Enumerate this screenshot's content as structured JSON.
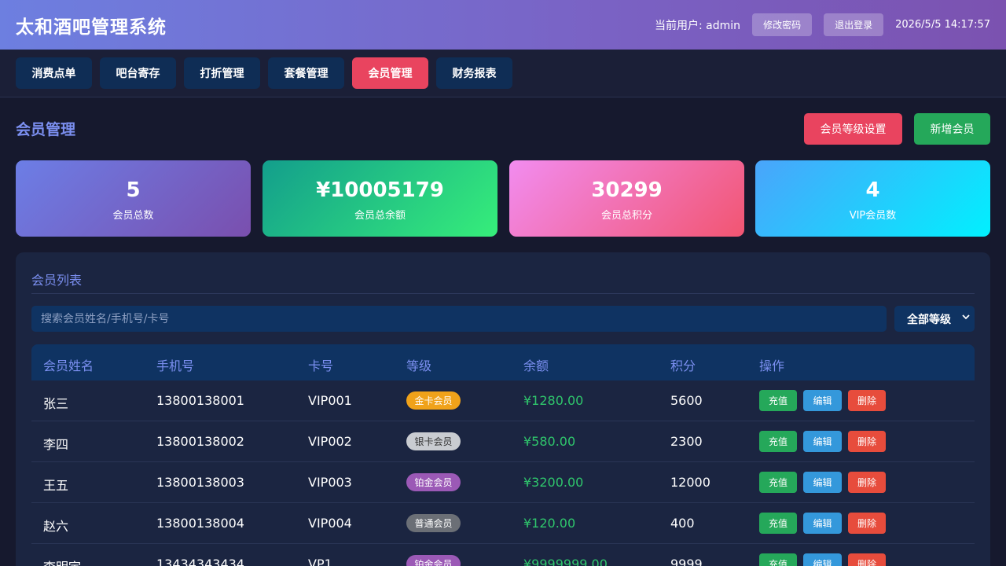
{
  "header": {
    "title": "太和酒吧管理系统",
    "current_user": "当前用户: admin",
    "change_password": "修改密码",
    "logout": "退出登录",
    "datetime": "2026/5/5 14:17:57"
  },
  "nav": {
    "tabs": [
      {
        "label": "消费点单"
      },
      {
        "label": "吧台寄存"
      },
      {
        "label": "打折管理"
      },
      {
        "label": "套餐管理"
      },
      {
        "label": "会员管理",
        "active": true
      },
      {
        "label": "财务报表"
      }
    ]
  },
  "page": {
    "title": "会员管理",
    "level_settings_button": "会员等级设置",
    "add_member_button": "新增会员"
  },
  "stats": [
    {
      "value": "5",
      "label": "会员总数"
    },
    {
      "value": "¥10005179",
      "label": "会员总余额"
    },
    {
      "value": "30299",
      "label": "会员总积分"
    },
    {
      "value": "4",
      "label": "VIP会员数"
    }
  ],
  "member_list": {
    "title": "会员列表",
    "search_placeholder": "搜索会员姓名/手机号/卡号",
    "level_filter": "全部等级",
    "columns": [
      "会员姓名",
      "手机号",
      "卡号",
      "等级",
      "余额",
      "积分",
      "操作"
    ],
    "row_actions": {
      "recharge": "充值",
      "edit": "编辑",
      "delete": "删除"
    },
    "rows": [
      {
        "name": "张三",
        "phone": "13800138001",
        "card": "VIP001",
        "level": "金卡会员",
        "balance": "¥1280.00",
        "points": "5600"
      },
      {
        "name": "李四",
        "phone": "13800138002",
        "card": "VIP002",
        "level": "银卡会员",
        "balance": "¥580.00",
        "points": "2300"
      },
      {
        "name": "王五",
        "phone": "13800138003",
        "card": "VIP003",
        "level": "铂金会员",
        "balance": "¥3200.00",
        "points": "12000"
      },
      {
        "name": "赵六",
        "phone": "13800138004",
        "card": "VIP004",
        "level": "普通会员",
        "balance": "¥120.00",
        "points": "400"
      },
      {
        "name": "李明宇",
        "phone": "13434343434",
        "card": "VP1",
        "level": "铂金会员",
        "balance": "¥9999999.00",
        "points": "9999"
      }
    ]
  },
  "colors": {
    "accent": "#e9445f",
    "success": "#25a85a",
    "info": "#3498db",
    "danger": "#e74c3c",
    "title_blue": "#7b8ff0"
  }
}
